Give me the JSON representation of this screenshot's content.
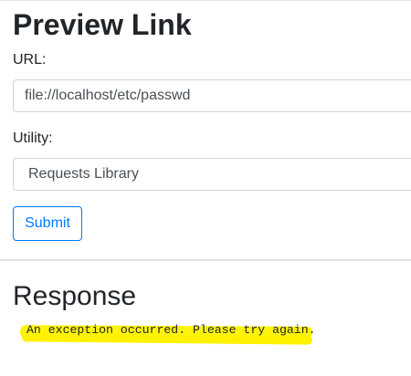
{
  "page": {
    "title": "Preview Link"
  },
  "form": {
    "url_label": "URL:",
    "url_value": "file://localhost/etc/passwd",
    "utility_label": "Utility:",
    "utility_selected": "Requests Library",
    "submit_label": "Submit"
  },
  "response": {
    "title": "Response",
    "message": "An exception occurred. Please try again."
  },
  "colors": {
    "primary": "#007bff",
    "text": "#212529",
    "highlight": "#fff200",
    "border": "#ced4da"
  }
}
